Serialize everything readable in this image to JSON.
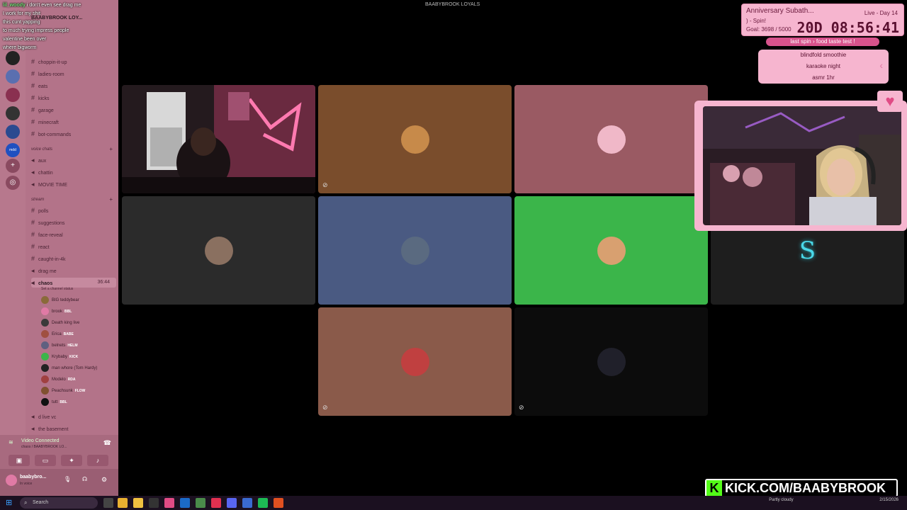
{
  "chat": [
    {
      "user": "lil_woody",
      "message": "i don't even see drag me"
    },
    {
      "user": "",
      "message": "I work for my shit"
    },
    {
      "user": "",
      "message": "this cunt yapping"
    },
    {
      "user": "",
      "message": "to much trying impress people"
    },
    {
      "user": "",
      "message": "valentine been over"
    },
    {
      "user": "",
      "message": "where bigworm"
    }
  ],
  "server": {
    "name": "BAABYBROOK LOY..."
  },
  "channels": [
    {
      "name": "choppin-it-up",
      "type": "text"
    },
    {
      "name": "ladies-room",
      "type": "text"
    },
    {
      "name": "eats",
      "type": "text"
    },
    {
      "name": "kicks",
      "type": "text"
    },
    {
      "name": "garage",
      "type": "text"
    },
    {
      "name": "minecraft",
      "type": "text"
    },
    {
      "name": "bot-commands",
      "type": "text"
    }
  ],
  "voice_category": "voice chats",
  "voice_channels": [
    "aux",
    "chattin",
    "MOVIE TIME"
  ],
  "stream_category": "stream",
  "stream_channels": [
    {
      "name": "polls",
      "type": "text"
    },
    {
      "name": "suggestions",
      "type": "text"
    },
    {
      "name": "face-reveal",
      "type": "text"
    },
    {
      "name": "react",
      "type": "text"
    },
    {
      "name": "caught-in-4k",
      "type": "text"
    },
    {
      "name": "drag me",
      "type": "voice"
    }
  ],
  "active_channel": {
    "name": "chaos",
    "time": "36:44",
    "status": "Set a channel status"
  },
  "members": [
    {
      "name": "BIG teddybear",
      "tag": "",
      "color": "#8a6a3a"
    },
    {
      "name": "brook",
      "tag": "BBL",
      "color": "#e07aa5"
    },
    {
      "name": "Death king live",
      "tag": "",
      "color": "#3a3a3a"
    },
    {
      "name": "Erica",
      "tag": "BABE",
      "color": "#a05040"
    },
    {
      "name": "belnets",
      "tag": "HELM",
      "color": "#606080"
    },
    {
      "name": "Krybaby",
      "tag": "KICK",
      "color": "#3bb54a"
    },
    {
      "name": "man whore (Tom Hardy)",
      "tag": "",
      "color": "#222"
    },
    {
      "name": "Modelo",
      "tag": "RDA",
      "color": "#a04040"
    },
    {
      "name": "Peachsunk",
      "tag": "FLOW",
      "color": "#805030"
    },
    {
      "name": "tutt",
      "tag": "BBL",
      "color": "#111"
    }
  ],
  "after_channels": [
    "d live vc",
    "the basement"
  ],
  "voice_panel": {
    "status": "Video Connected",
    "sub": "chaos / BAABYBROOK LO..."
  },
  "user_panel": {
    "name": "baabybro...",
    "sub": "In voice"
  },
  "call_title": "BAABYBROOK LOYALS",
  "tiles": [
    {
      "bg": "#1a1216",
      "avatar": "webcam"
    },
    {
      "bg": "#7a4d2c",
      "avatar": "#c78a4a"
    },
    {
      "bg": "#9a5a63",
      "avatar": "#f0b8c8"
    },
    {
      "bg": "#2b2b2b",
      "avatar": "#8a7060"
    },
    {
      "bg": "#4a5a82",
      "avatar": "#5a6a80"
    },
    {
      "bg": "#3bb54a",
      "avatar": "#d8a070"
    },
    {
      "bg": "#1e1e1e",
      "avatar": "S"
    },
    {
      "bg": "#8a5a4a",
      "avatar": "#c04040"
    },
    {
      "bg": "#0c0c0c",
      "avatar": "#20202a"
    }
  ],
  "subathon": {
    "title": "Anniversary Subath...",
    "line2": ") - Spin!",
    "goal": "Goal: 3698 / 5000",
    "live": "Live - Day 14",
    "timer": "20D 08:56:41"
  },
  "spin_bar": {
    "label1": "last spin",
    "label2": "food taste test !"
  },
  "spin_list": [
    "blindfold smoothie",
    "karaoke night",
    "asmr 1hr"
  ],
  "kick": {
    "k": "K",
    "text": "KICK.COM/BAABYBROOK"
  },
  "taskbar": {
    "search": "Search",
    "tray": "Partly cloudy",
    "date": "2/15/2026"
  }
}
